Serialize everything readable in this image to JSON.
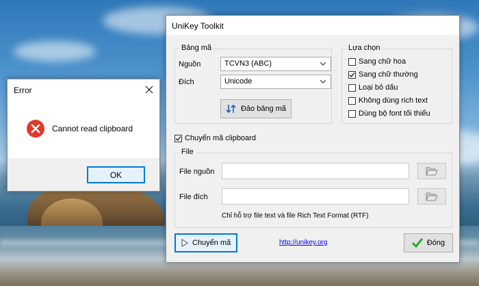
{
  "error_dialog": {
    "title": "Error",
    "message": "Cannot read clipboard",
    "ok_label": "OK"
  },
  "unikey": {
    "title": "UniKey Toolkit",
    "bang_ma": {
      "group_label": "Bảng mã",
      "source_label": "Nguồn",
      "source_value": "TCVN3 (ABC)",
      "target_label": "Đích",
      "target_value": "Unicode",
      "swap_label": "Đảo bảng mã"
    },
    "options": {
      "group_label": "Lựa chọn",
      "items": [
        {
          "label": "Sang chữ hoa",
          "checked": false
        },
        {
          "label": "Sang chữ thường",
          "checked": true
        },
        {
          "label": "Loại bỏ dấu",
          "checked": false
        },
        {
          "label": "Không dùng rich text",
          "checked": false
        },
        {
          "label": "Dùng bộ font tối thiểu",
          "checked": false
        }
      ]
    },
    "clipboard": {
      "label": "Chuyển mã clipboard",
      "checked": true
    },
    "file": {
      "group_label": "File",
      "source_label": "File nguồn",
      "source_value": "",
      "target_label": "File đích",
      "target_value": "",
      "note": "Chỉ hỗ trợ file text và file Rich Text Format (RTF)"
    },
    "convert_label": "Chuyển mã",
    "link": "http://unikey.org",
    "close_label": "Đóng"
  },
  "colors": {
    "error_red": "#e0392b",
    "focus_blue": "#0078d7",
    "check_green": "#2aa52a"
  }
}
